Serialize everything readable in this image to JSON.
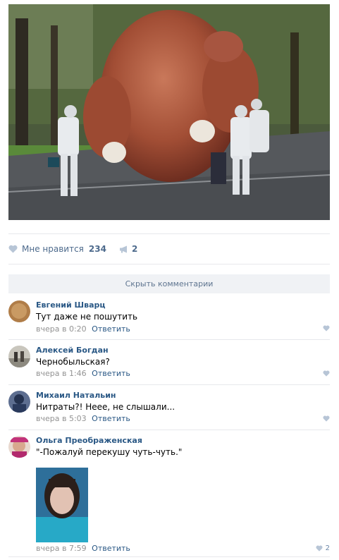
{
  "post": {
    "photo_icon": "inflatable-chicken-photo",
    "likes_label": "Мне нравится",
    "likes_count": "234",
    "shares_count": "2"
  },
  "comments_toggle": {
    "label": "Скрыть комментарии"
  },
  "comments": [
    {
      "author": "Евгений Шварц",
      "text": "Тут даже не пошутить",
      "date": "вчера в 0:20",
      "reply": "Ответить"
    },
    {
      "author": "Алексей Богдан",
      "text": "Чернобыльская?",
      "date": "вчера в 1:46",
      "reply": "Ответить"
    },
    {
      "author": "Михаил Натальин",
      "text": "Нитраты?! Неее, не слышали...",
      "date": "вчера в 5:03",
      "reply": "Ответить"
    },
    {
      "author": "Ольга Преображенская",
      "text": "\"-Пожалуй перекушу чуть-чуть.\"",
      "date": "вчера в 7:59",
      "reply": "Ответить",
      "likes": "2",
      "attachment_icon": "woman-photo"
    }
  ],
  "colors": {
    "link": "#2a5885",
    "action": "#4d6a8c",
    "muted": "#939393",
    "like_icon": "#b7c5d6"
  }
}
